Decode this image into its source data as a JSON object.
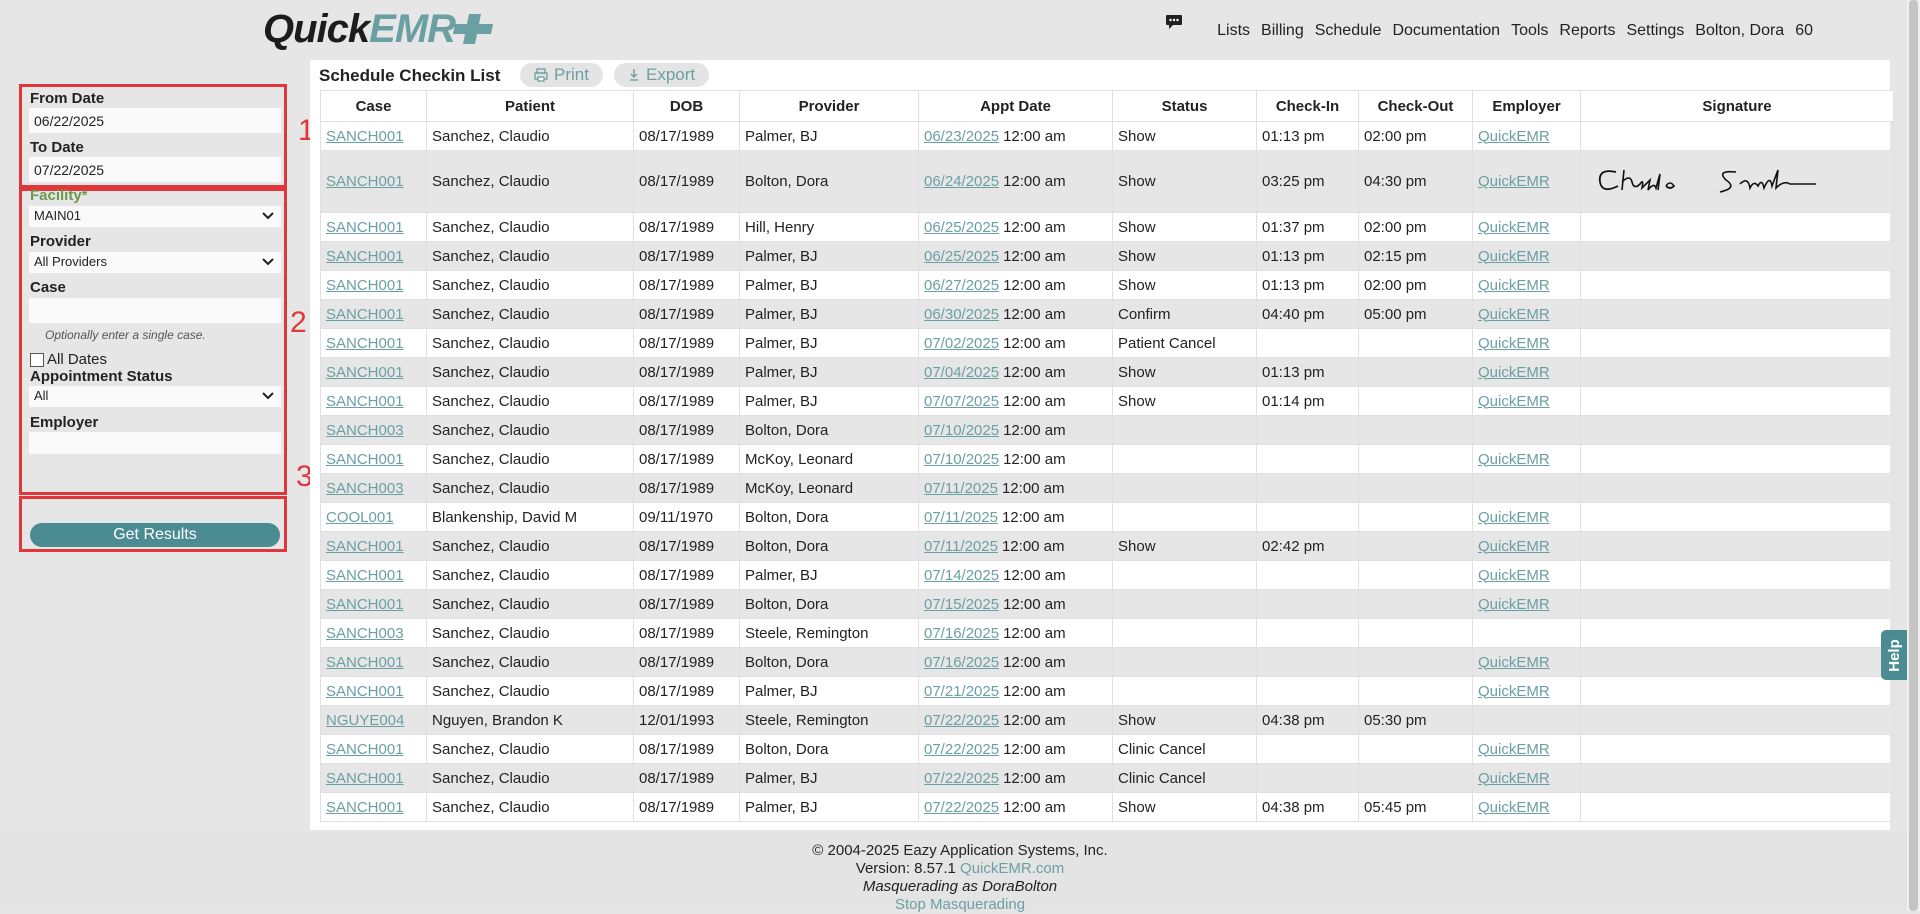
{
  "logo": {
    "part1": "Quick",
    "part2": "EMR",
    "plus_color": "#6a9fa3"
  },
  "nav": {
    "items": [
      "Lists",
      "Billing",
      "Schedule",
      "Documentation",
      "Tools",
      "Reports",
      "Settings",
      "Bolton, Dora",
      "60"
    ]
  },
  "filters": {
    "from_date_label": "From Date",
    "from_date_value": "06/22/2025",
    "to_date_label": "To Date",
    "to_date_value": "07/22/2025",
    "facility_label": "Facility*",
    "facility_value": "MAIN01",
    "provider_label": "Provider",
    "provider_value": "All Providers",
    "case_label": "Case",
    "case_value": "",
    "case_hint": "Optionally enter a single case.",
    "all_dates_label": "All Dates",
    "appt_status_label": "Appointment Status",
    "appt_status_value": "All",
    "employer_label": "Employer",
    "employer_value": "",
    "get_results": "Get Results",
    "steps": [
      "1",
      "2",
      "3"
    ]
  },
  "main": {
    "title": "Schedule Checkin List",
    "print": "Print",
    "export": "Export",
    "columns": [
      "Case",
      "Patient",
      "DOB",
      "Provider",
      "Appt Date",
      "Status",
      "Check-In",
      "Check-Out",
      "Employer",
      "Signature"
    ],
    "rows": [
      {
        "case": "SANCH001",
        "patient": "Sanchez, Claudio",
        "dob": "08/17/1989",
        "provider": "Palmer, BJ",
        "date": "06/23/2025",
        "time": "12:00 am",
        "status": "Show",
        "checkin": "01:13 pm",
        "checkout": "02:00 pm",
        "employer": "QuickEMR",
        "sig": ""
      },
      {
        "case": "SANCH001",
        "patient": "Sanchez, Claudio",
        "dob": "08/17/1989",
        "provider": "Bolton, Dora",
        "date": "06/24/2025",
        "time": "12:00 am",
        "status": "Show",
        "checkin": "03:25 pm",
        "checkout": "04:30 pm",
        "employer": "QuickEMR",
        "sig": "signature"
      },
      {
        "case": "SANCH001",
        "patient": "Sanchez, Claudio",
        "dob": "08/17/1989",
        "provider": "Hill, Henry",
        "date": "06/25/2025",
        "time": "12:00 am",
        "status": "Show",
        "checkin": "01:37 pm",
        "checkout": "02:00 pm",
        "employer": "QuickEMR",
        "sig": ""
      },
      {
        "case": "SANCH001",
        "patient": "Sanchez, Claudio",
        "dob": "08/17/1989",
        "provider": "Palmer, BJ",
        "date": "06/25/2025",
        "time": "12:00 am",
        "status": "Show",
        "checkin": "01:13 pm",
        "checkout": "02:15 pm",
        "employer": "QuickEMR",
        "sig": ""
      },
      {
        "case": "SANCH001",
        "patient": "Sanchez, Claudio",
        "dob": "08/17/1989",
        "provider": "Palmer, BJ",
        "date": "06/27/2025",
        "time": "12:00 am",
        "status": "Show",
        "checkin": "01:13 pm",
        "checkout": "02:00 pm",
        "employer": "QuickEMR",
        "sig": ""
      },
      {
        "case": "SANCH001",
        "patient": "Sanchez, Claudio",
        "dob": "08/17/1989",
        "provider": "Palmer, BJ",
        "date": "06/30/2025",
        "time": "12:00 am",
        "status": "Confirm",
        "checkin": "04:40 pm",
        "checkout": "05:00 pm",
        "employer": "QuickEMR",
        "sig": ""
      },
      {
        "case": "SANCH001",
        "patient": "Sanchez, Claudio",
        "dob": "08/17/1989",
        "provider": "Palmer, BJ",
        "date": "07/02/2025",
        "time": "12:00 am",
        "status": "Patient Cancel",
        "checkin": "",
        "checkout": "",
        "employer": "QuickEMR",
        "sig": ""
      },
      {
        "case": "SANCH001",
        "patient": "Sanchez, Claudio",
        "dob": "08/17/1989",
        "provider": "Palmer, BJ",
        "date": "07/04/2025",
        "time": "12:00 am",
        "status": "Show",
        "checkin": "01:13 pm",
        "checkout": "",
        "employer": "QuickEMR",
        "sig": ""
      },
      {
        "case": "SANCH001",
        "patient": "Sanchez, Claudio",
        "dob": "08/17/1989",
        "provider": "Palmer, BJ",
        "date": "07/07/2025",
        "time": "12:00 am",
        "status": "Show",
        "checkin": "01:14 pm",
        "checkout": "",
        "employer": "QuickEMR",
        "sig": ""
      },
      {
        "case": "SANCH003",
        "patient": "Sanchez, Claudio",
        "dob": "08/17/1989",
        "provider": "Bolton, Dora",
        "date": "07/10/2025",
        "time": "12:00 am",
        "status": "",
        "checkin": "",
        "checkout": "",
        "employer": "",
        "sig": ""
      },
      {
        "case": "SANCH001",
        "patient": "Sanchez, Claudio",
        "dob": "08/17/1989",
        "provider": "McKoy, Leonard",
        "date": "07/10/2025",
        "time": "12:00 am",
        "status": "",
        "checkin": "",
        "checkout": "",
        "employer": "QuickEMR",
        "sig": ""
      },
      {
        "case": "SANCH003",
        "patient": "Sanchez, Claudio",
        "dob": "08/17/1989",
        "provider": "McKoy, Leonard",
        "date": "07/11/2025",
        "time": "12:00 am",
        "status": "",
        "checkin": "",
        "checkout": "",
        "employer": "",
        "sig": ""
      },
      {
        "case": "COOL001",
        "patient": "Blankenship, David M",
        "dob": "09/11/1970",
        "provider": "Bolton, Dora",
        "date": "07/11/2025",
        "time": "12:00 am",
        "status": "",
        "checkin": "",
        "checkout": "",
        "employer": "QuickEMR",
        "sig": ""
      },
      {
        "case": "SANCH001",
        "patient": "Sanchez, Claudio",
        "dob": "08/17/1989",
        "provider": "Bolton, Dora",
        "date": "07/11/2025",
        "time": "12:00 am",
        "status": "Show",
        "checkin": "02:42 pm",
        "checkout": "",
        "employer": "QuickEMR",
        "sig": ""
      },
      {
        "case": "SANCH001",
        "patient": "Sanchez, Claudio",
        "dob": "08/17/1989",
        "provider": "Palmer, BJ",
        "date": "07/14/2025",
        "time": "12:00 am",
        "status": "",
        "checkin": "",
        "checkout": "",
        "employer": "QuickEMR",
        "sig": ""
      },
      {
        "case": "SANCH001",
        "patient": "Sanchez, Claudio",
        "dob": "08/17/1989",
        "provider": "Bolton, Dora",
        "date": "07/15/2025",
        "time": "12:00 am",
        "status": "",
        "checkin": "",
        "checkout": "",
        "employer": "QuickEMR",
        "sig": ""
      },
      {
        "case": "SANCH003",
        "patient": "Sanchez, Claudio",
        "dob": "08/17/1989",
        "provider": "Steele, Remington",
        "date": "07/16/2025",
        "time": "12:00 am",
        "status": "",
        "checkin": "",
        "checkout": "",
        "employer": "",
        "sig": ""
      },
      {
        "case": "SANCH001",
        "patient": "Sanchez, Claudio",
        "dob": "08/17/1989",
        "provider": "Bolton, Dora",
        "date": "07/16/2025",
        "time": "12:00 am",
        "status": "",
        "checkin": "",
        "checkout": "",
        "employer": "QuickEMR",
        "sig": ""
      },
      {
        "case": "SANCH001",
        "patient": "Sanchez, Claudio",
        "dob": "08/17/1989",
        "provider": "Palmer, BJ",
        "date": "07/21/2025",
        "time": "12:00 am",
        "status": "",
        "checkin": "",
        "checkout": "",
        "employer": "QuickEMR",
        "sig": ""
      },
      {
        "case": "NGUYE004",
        "patient": "Nguyen, Brandon K",
        "dob": "12/01/1993",
        "provider": "Steele, Remington",
        "date": "07/22/2025",
        "time": "12:00 am",
        "status": "Show",
        "checkin": "04:38 pm",
        "checkout": "05:30 pm",
        "employer": "",
        "sig": ""
      },
      {
        "case": "SANCH001",
        "patient": "Sanchez, Claudio",
        "dob": "08/17/1989",
        "provider": "Bolton, Dora",
        "date": "07/22/2025",
        "time": "12:00 am",
        "status": "Clinic Cancel",
        "checkin": "",
        "checkout": "",
        "employer": "QuickEMR",
        "sig": ""
      },
      {
        "case": "SANCH001",
        "patient": "Sanchez, Claudio",
        "dob": "08/17/1989",
        "provider": "Palmer, BJ",
        "date": "07/22/2025",
        "time": "12:00 am",
        "status": "Clinic Cancel",
        "checkin": "",
        "checkout": "",
        "employer": "QuickEMR",
        "sig": ""
      },
      {
        "case": "SANCH001",
        "patient": "Sanchez, Claudio",
        "dob": "08/17/1989",
        "provider": "Palmer, BJ",
        "date": "07/22/2025",
        "time": "12:00 am",
        "status": "Show",
        "checkin": "04:38 pm",
        "checkout": "05:45 pm",
        "employer": "QuickEMR",
        "sig": ""
      }
    ]
  },
  "footer": {
    "copyright": "© 2004-2025 Eazy Application Systems, Inc.",
    "version": "Version: 8.57.1",
    "site": "QuickEMR.com",
    "masquerade": "Masquerading as DoraBolton",
    "stop": "Stop Masquerading"
  },
  "help": "Help",
  "colors": {
    "accent": "#4a8c92",
    "link": "#6a9fa3",
    "highlight": "#e0363c"
  }
}
